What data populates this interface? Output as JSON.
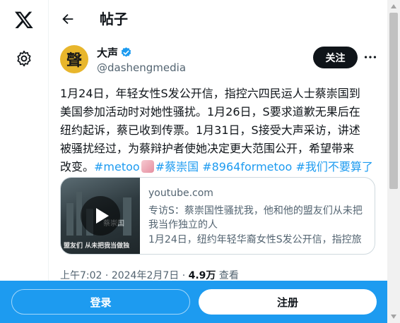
{
  "nav": {
    "logo_icon": "x-logo-icon",
    "settings_icon": "gear-icon"
  },
  "header": {
    "title": "帖子",
    "back_icon": "back-arrow-icon"
  },
  "author": {
    "avatar_char": "聲",
    "avatar_color": "#e8b62c",
    "name": "大声",
    "handle": "@dashengmedia",
    "verified": true,
    "follow_label": "关注",
    "more_icon": "more-icon"
  },
  "post": {
    "lines": [
      "1月24日，年轻女性S发公开信，指控六四民运人士蔡崇国到",
      "美国参加活动时对她性骚扰。1月26日，S要求道歉无果后在",
      "纽约起诉，蔡已收到传票。1月31日，S接受大声采访，讲述",
      "被骚扰经过，为蔡辩护者使她决定更大范围公开，希望带来"
    ],
    "last_line_prefix": "改变。",
    "hashtags": [
      "#metoo",
      "#蔡崇国",
      "#8964formetoo",
      "#我们不要算了"
    ]
  },
  "card": {
    "domain": "youtube.com",
    "title": "专访S：蔡崇国性骚扰我，他和他的盟友们从未把我当作独立的人",
    "description": "1月24日，纽约年轻华裔女性S发公开信，指控旅",
    "thumb_caption": "盟友们 从未把我当做独",
    "thumb_caption2": "蔡崇国"
  },
  "meta": {
    "time": "上午7:02",
    "sep": " · ",
    "date": "2024年2月7日",
    "views": "4.9万",
    "views_label": "查看"
  },
  "bottom": {
    "login_label": "登录",
    "signup_label": "注册"
  },
  "colors": {
    "accent": "#1d9bf0",
    "text": "#0f1419",
    "muted": "#536471"
  }
}
